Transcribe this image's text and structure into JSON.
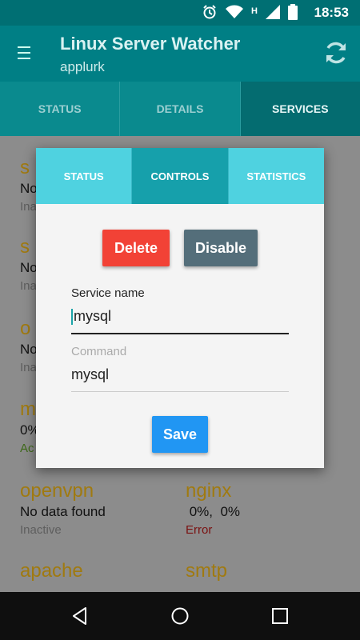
{
  "status_bar": {
    "time": "18:53",
    "network_label": "H",
    "icons": [
      "alarm-icon",
      "wifi-icon",
      "signal-icon",
      "battery-icon"
    ]
  },
  "app_bar": {
    "title": "Linux Server Watcher",
    "subtitle": "applurk"
  },
  "tabs": [
    {
      "label": "STATUS",
      "active": false
    },
    {
      "label": "DETAILS",
      "active": false
    },
    {
      "label": "SERVICES",
      "active": true
    }
  ],
  "services": [
    {
      "name": "openvpn",
      "status": "No data found",
      "state": "Inactive",
      "state_type": "inactive"
    },
    {
      "name": "nginx",
      "status": " 0%,  0%",
      "state": "Error",
      "state_type": "error"
    },
    {
      "name": "apache",
      "status": "",
      "state": "",
      "state_type": "inactive"
    },
    {
      "name": "smtp",
      "status": "",
      "state": "",
      "state_type": "inactive"
    }
  ],
  "partial_items": [
    {
      "name": "s",
      "status": "No",
      "state": "Ina"
    },
    {
      "name": "s",
      "status": "No",
      "state": "Ina"
    },
    {
      "name": "o",
      "status": "No",
      "state": "Ina"
    },
    {
      "name": "m",
      "status": " 0%",
      "state": "Ac"
    }
  ],
  "dialog": {
    "tabs": [
      {
        "label": "STATUS",
        "active": false
      },
      {
        "label": "CONTROLS",
        "active": true
      },
      {
        "label": "STATISTICS",
        "active": false
      }
    ],
    "delete_label": "Delete",
    "disable_label": "Disable",
    "service_name_label": "Service name",
    "service_name_value": "mysql",
    "command_label": "Command",
    "command_value": "mysql",
    "save_label": "Save"
  },
  "colors": {
    "primary": "#007f85",
    "accent_tab": "#4fd2e0",
    "delete": "#f24236",
    "disable": "#546e7a",
    "save": "#2196f3",
    "service_name": "#a07a10"
  }
}
